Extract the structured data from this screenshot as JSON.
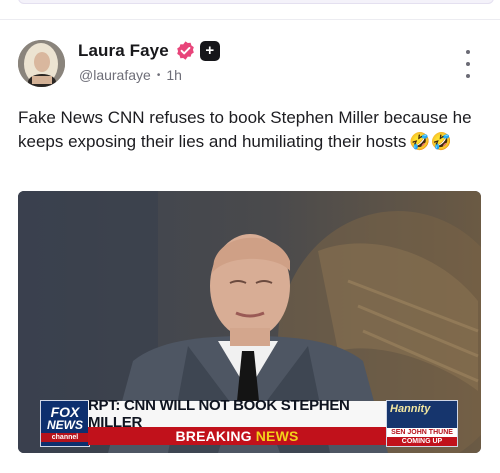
{
  "post": {
    "author_name": "Laura Faye",
    "handle": "@laurafaye",
    "time_ago": "1h",
    "separator": "•",
    "text": "Fake News CNN refuses to book Stephen Miller because he keeps exposing their lies and humiliating their hosts",
    "text_emoji": "🤣🤣",
    "plus_badge": "+"
  },
  "media": {
    "chyron_headline": "RPT: CNN WILL NOT BOOK STEPHEN MILLER",
    "breaking_label": "BREAKING",
    "breaking_accent": "NEWS",
    "network_logo_line1": "FOX",
    "network_logo_line2": "NEWS",
    "network_logo_line3": "channel",
    "show_name": "Hannity",
    "show_guest": "SEN JOHN THUNE",
    "show_status": "COMING UP"
  },
  "colors": {
    "verified_badge": "#e8457a",
    "chyron_red": "#c1111b",
    "fox_blue": "#0d2f6e"
  },
  "icons": {
    "verified": "verified-badge-icon",
    "plus": "plus-badge-icon",
    "menu": "more-vertical-icon"
  }
}
